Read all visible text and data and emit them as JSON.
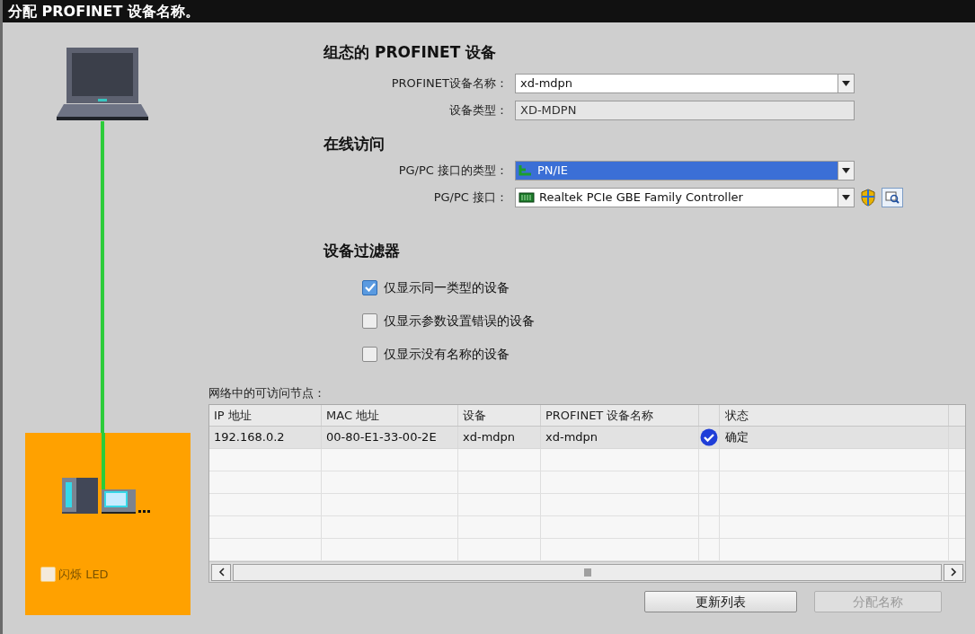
{
  "window": {
    "title": "分配 PROFINET 设备名称。"
  },
  "configured": {
    "heading": "组态的 PROFINET 设备",
    "fields": [
      {
        "label": "PROFINET设备名称：",
        "value": "xd-mdpn",
        "kind": "combo",
        "focused": false
      },
      {
        "label": "设备类型：",
        "value": "XD-MDPN",
        "kind": "readonly",
        "focused": false
      }
    ]
  },
  "online": {
    "heading": "在线访问",
    "fields": [
      {
        "label": "PG/PC 接口的类型：",
        "value": "PN/IE",
        "kind": "combo-network",
        "focused": true
      },
      {
        "label": "PG/PC 接口：",
        "value": "Realtek PCIe GBE Family Controller",
        "kind": "combo-adapter",
        "focused": false
      }
    ]
  },
  "filter": {
    "heading": "设备过滤器",
    "options": [
      {
        "label": "仅显示同一类型的设备",
        "checked": true
      },
      {
        "label": "仅显示参数设置错误的设备",
        "checked": false
      },
      {
        "label": "仅显示没有名称的设备",
        "checked": false
      }
    ]
  },
  "device_panel": {
    "led": {
      "label": "闪烁 LED",
      "checked": false,
      "disabled": true
    }
  },
  "table": {
    "title": "网络中的可访问节点：",
    "columns": [
      "IP 地址",
      "MAC 地址",
      "设备",
      "PROFINET 设备名称",
      "状态"
    ],
    "rows": [
      {
        "ip": "192.168.0.2",
        "mac": "00-80-E1-33-00-2E",
        "device": "xd-mdpn",
        "name": "xd-mdpn",
        "status": "确定",
        "status_ok": true,
        "selected": true
      }
    ]
  },
  "buttons": [
    {
      "label": "更新列表",
      "disabled": false
    },
    {
      "label": "分配名称",
      "disabled": true
    }
  ]
}
